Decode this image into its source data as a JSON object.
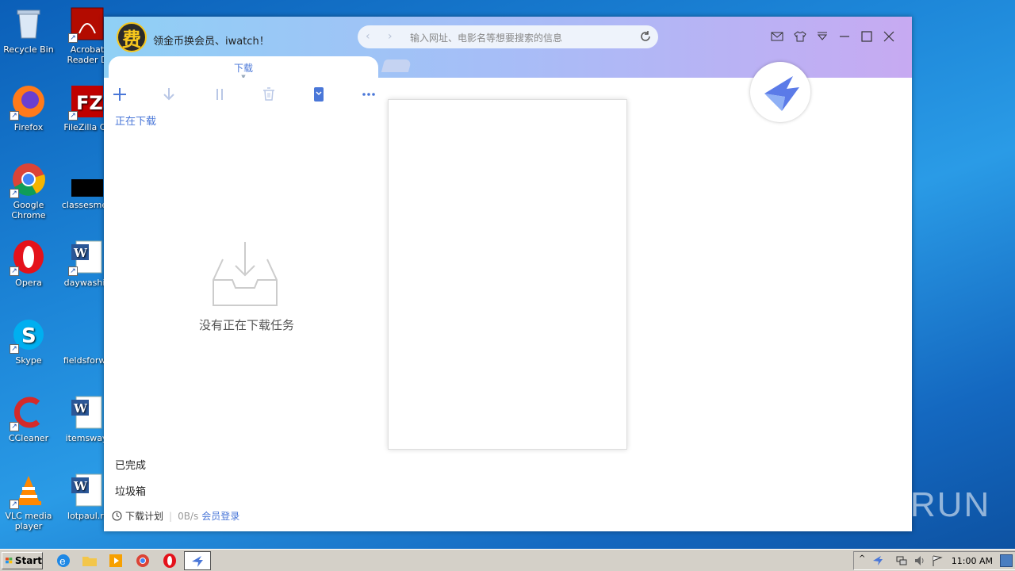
{
  "desktop": {
    "icons": [
      {
        "label": "Recycle Bin"
      },
      {
        "label": "Acrobat Reader D"
      },
      {
        "label": "Firefox"
      },
      {
        "label": "FileZilla Cli"
      },
      {
        "label": "Google Chrome"
      },
      {
        "label": "classesmen"
      },
      {
        "label": "Opera"
      },
      {
        "label": "daywashin"
      },
      {
        "label": "Skype"
      },
      {
        "label": "fieldsforwa"
      },
      {
        "label": "CCleaner"
      },
      {
        "label": "itemsway."
      },
      {
        "label": "VLC media player"
      },
      {
        "label": "lotpaul.rt"
      }
    ]
  },
  "app": {
    "brand_badge": "费",
    "promo_text": "领金币换会员、iwatch！",
    "url_placeholder": "输入网址、电影名等想要搜索的信息",
    "tab_label": "下载",
    "sections": {
      "downloading": "正在下载",
      "completed": "已完成",
      "trash": "垃圾箱"
    },
    "empty_message": "没有正在下载任务",
    "footer": {
      "plan": "下载计划",
      "speed": "0B/s",
      "login": "会员登录"
    },
    "accent_color": "#4a77d8"
  },
  "watermark": "ANY RUN",
  "taskbar": {
    "start_label": "Start",
    "clock": "11:00 AM"
  }
}
